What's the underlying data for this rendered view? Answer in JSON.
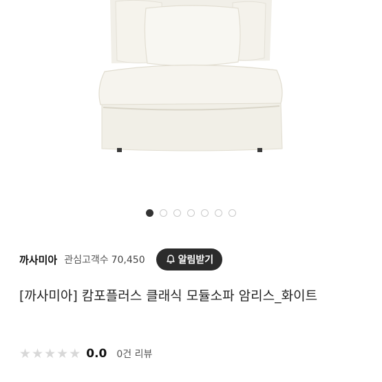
{
  "carousel": {
    "total": 7,
    "active": 0
  },
  "store": {
    "name": "까사미아",
    "followers_label": "관심고객수",
    "followers_count": "70,450",
    "notify_button": "알림받기"
  },
  "product": {
    "title": "[까사미아] 캄포플러스 클래식 모듈소파 암리스_화이트"
  },
  "rating": {
    "stars_filled": 0,
    "stars_total": 5,
    "score": "0.0",
    "review_count": "0건",
    "review_label": "리뷰"
  }
}
